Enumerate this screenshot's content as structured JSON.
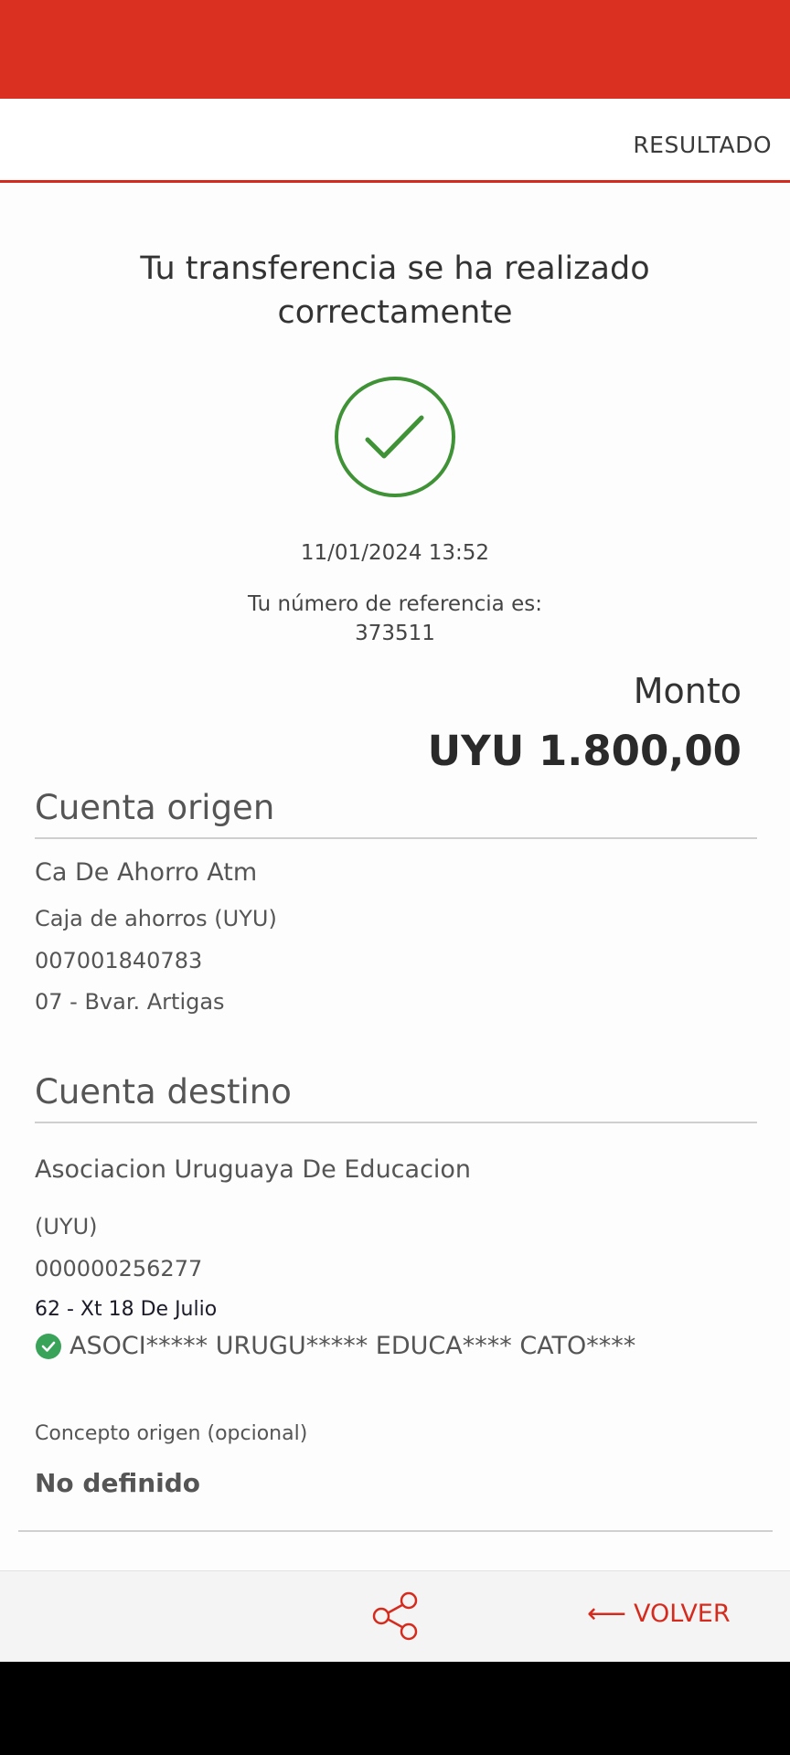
{
  "header": {
    "step_label": "RESULTADO"
  },
  "result": {
    "title": "Tu transferencia se ha realizado correctamente",
    "datetime": "11/01/2024 13:52",
    "reference_label": "Tu número de referencia es:",
    "reference_number": "373511",
    "amount_label": "Monto",
    "amount_value": "UYU 1.800,00"
  },
  "origin": {
    "title": "Cuenta origen",
    "name": "Ca De Ahorro Atm",
    "type": "Caja de ahorros (UYU)",
    "number": "007001840783",
    "branch": "07 - Bvar. Artigas"
  },
  "destination": {
    "title": "Cuenta destino",
    "name": "Asociacion Uruguaya De Educacion",
    "currency": "(UYU)",
    "number": "000000256277",
    "branch": "62 - Xt 18 De Julio",
    "verified_holder": "ASOCI***** URUGU***** EDUCA**** CATO****"
  },
  "concept": {
    "label": "Concepto origen (opcional)",
    "value": "No definido"
  },
  "footer": {
    "back_label": "VOLVER"
  },
  "colors": {
    "brand_red": "#da3021",
    "success_green": "#3f9236",
    "verified_green": "#3aa35a"
  },
  "icons": {
    "success": "check-circle-icon",
    "verified": "verified-badge-icon",
    "share": "share-icon",
    "back": "arrow-left-icon"
  }
}
